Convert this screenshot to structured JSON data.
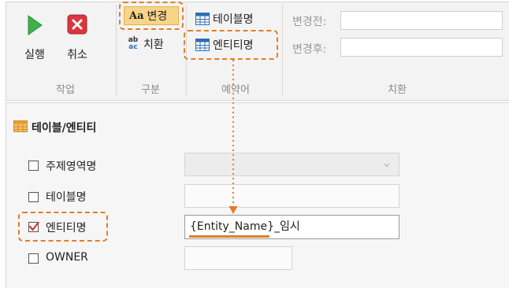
{
  "ribbon": {
    "run_label": "실행",
    "cancel_label": "취소",
    "group_work": "작업",
    "change_label": "변경",
    "replace_label": "치환",
    "group_type": "구분",
    "table_name_label": "테이블명",
    "entity_name_label": "엔티티명",
    "group_reserved": "예약어",
    "before_label": "변경전:",
    "after_label": "변경후:",
    "group_replace": "치환",
    "aa_glyph": "Aa",
    "ab_glyph_top": "ab",
    "ab_glyph_bottom": "ac"
  },
  "panel": {
    "title": "테이블/엔티티",
    "rows": [
      {
        "label": "주제영역명",
        "checked": false,
        "value": ""
      },
      {
        "label": "테이블명",
        "checked": false,
        "value": ""
      },
      {
        "label": "엔티티명",
        "checked": true,
        "value": "{Entity_Name}_임시"
      },
      {
        "label": "OWNER",
        "checked": false,
        "value": ""
      }
    ]
  },
  "colors": {
    "highlight": "#e07f28",
    "run_green": "#3fb24a",
    "cancel_red": "#d9363e",
    "check_red": "#d33a2c",
    "grid_blue": "#2f6fb3"
  }
}
